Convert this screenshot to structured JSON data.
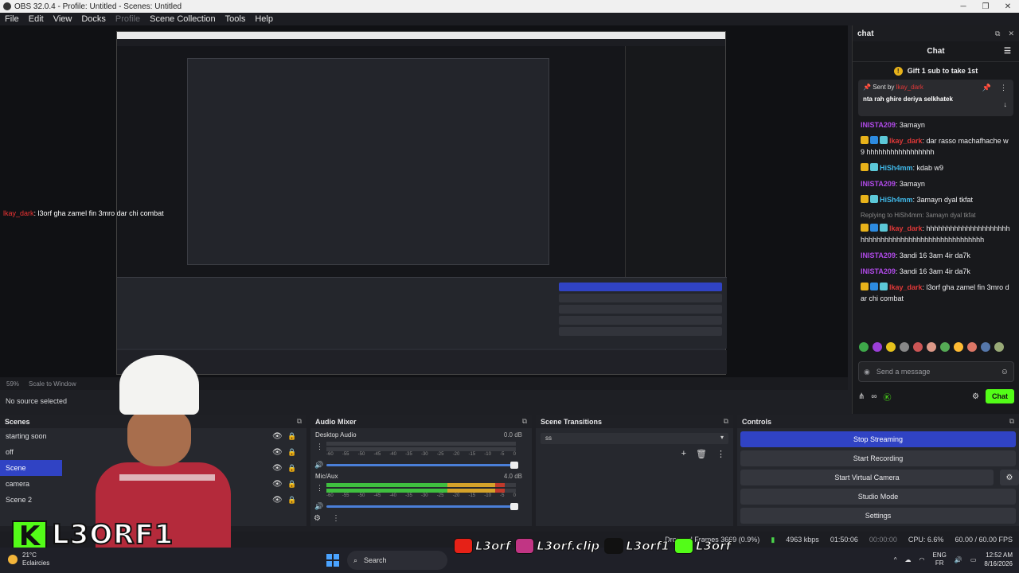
{
  "window": {
    "title": "OBS 32.0.4 - Profile: Untitled - Scenes: Untitled"
  },
  "menu": [
    "File",
    "Edit",
    "View",
    "Docks",
    "Profile",
    "Scene Collection",
    "Tools",
    "Help"
  ],
  "preview": {
    "overlay_user": "lkay_dark",
    "overlay_text": ": l3orf gha zamel fin 3mro dar chi combat",
    "zoom": "59%",
    "scale_label": "Scale to Window",
    "no_source": "No source selected"
  },
  "scenes": {
    "title": "Scenes",
    "items": [
      {
        "label": "starting soon",
        "active": false
      },
      {
        "label": "off",
        "active": false
      },
      {
        "label": "Scene",
        "active": true
      },
      {
        "label": "camera",
        "active": false
      },
      {
        "label": "Scene 2",
        "active": false
      }
    ]
  },
  "mixer": {
    "title": "Audio Mixer",
    "channels": [
      {
        "name": "Desktop Audio",
        "db": "0.0 dB"
      },
      {
        "name": "Mic/Aux",
        "db": "4.0 dB"
      }
    ],
    "scale": [
      "-60",
      "-55",
      "-50",
      "-45",
      "-40",
      "-35",
      "-30",
      "-25",
      "-20",
      "-15",
      "-10",
      "-5",
      "0"
    ]
  },
  "transitions": {
    "title": "Scene Transitions",
    "selected": "ss"
  },
  "controls": {
    "title": "Controls",
    "stop_streaming": "Stop Streaming",
    "start_recording": "Start Recording",
    "start_virtual_camera": "Start Virtual Camera",
    "studio_mode": "Studio Mode",
    "settings": "Settings"
  },
  "status": {
    "dropped": "Dropped Frames 3669 (0.9%)",
    "kbps": "4963 kbps",
    "stream_time": "01:50:06",
    "rec_time": "00:00:00",
    "cpu": "CPU: 6.6%",
    "fps": "60.00 / 60.00 FPS"
  },
  "chat": {
    "dock_title": "chat",
    "title": "Chat",
    "gift_banner": "Gift 1 sub to take 1st",
    "pinned_sentby": "Sent by",
    "pinned_user": "lkay_dark",
    "pinned_message": "nta rah ghire deriya selkhatek",
    "messages": [
      {
        "user": "INISTA209",
        "ucolor": "purple",
        "badges": [],
        "text": ": 3amayn"
      },
      {
        "user": "lkay_dark",
        "ucolor": "red",
        "badges": [
          "crown",
          "blue",
          "cyan"
        ],
        "text": ": dar rasso machafhache w9 hhhhhhhhhhhhhhhhh"
      },
      {
        "user": "HiSh4mm",
        "ucolor": "cyan",
        "badges": [
          "crown",
          "cyan"
        ],
        "text": ": kdab w9"
      },
      {
        "user": "INISTA209",
        "ucolor": "purple",
        "badges": [],
        "text": ": 3amayn"
      },
      {
        "user": "HiSh4mm",
        "ucolor": "cyan",
        "badges": [
          "crown",
          "cyan"
        ],
        "text": ": 3amayn dyal tkfat"
      },
      {
        "reply": "Replying to HiSh4mm: 3amayn dyal tkfat"
      },
      {
        "user": "lkay_dark",
        "ucolor": "red",
        "badges": [
          "crown",
          "blue",
          "cyan"
        ],
        "text": ": hhhhhhhhhhhhhhhhhhhhhhhhhhhhhhhhhhhhhhhhhhhhhhhhhhhh"
      },
      {
        "user": "INISTA209",
        "ucolor": "purple",
        "badges": [],
        "text": ": 3andi 16 3am 4ir da7k"
      },
      {
        "user": "INISTA209",
        "ucolor": "purple",
        "badges": [],
        "text": ": 3andi 16 3am 4ir da7k"
      },
      {
        "user": "lkay_dark",
        "ucolor": "red",
        "badges": [
          "crown",
          "blue",
          "cyan"
        ],
        "text": ": l3orf gha zamel fin 3mro dar chi combat"
      }
    ],
    "input_placeholder": "Send a message",
    "send_label": "Chat"
  },
  "overlay": {
    "logo_letter": "K",
    "logo_text": "L3ORF1",
    "socials": [
      {
        "platform": "youtube",
        "handle": "L3orf",
        "color": "#e62117"
      },
      {
        "platform": "instagram",
        "handle": "L3orf.clip",
        "color": "#c13584"
      },
      {
        "platform": "tiktok",
        "handle": "L3orf1",
        "color": "#111111"
      },
      {
        "platform": "kick",
        "handle": "L3orf",
        "color": "#53fc18"
      }
    ]
  },
  "taskbar": {
    "temp": "21°C",
    "weather": "Eclaircies",
    "search": "Search",
    "lang1": "ENG",
    "lang2": "FR",
    "time": "12:52 AM",
    "date": "8/16/2026"
  },
  "colors": {
    "accent": "#3043c4",
    "kick_green": "#53fc18"
  }
}
